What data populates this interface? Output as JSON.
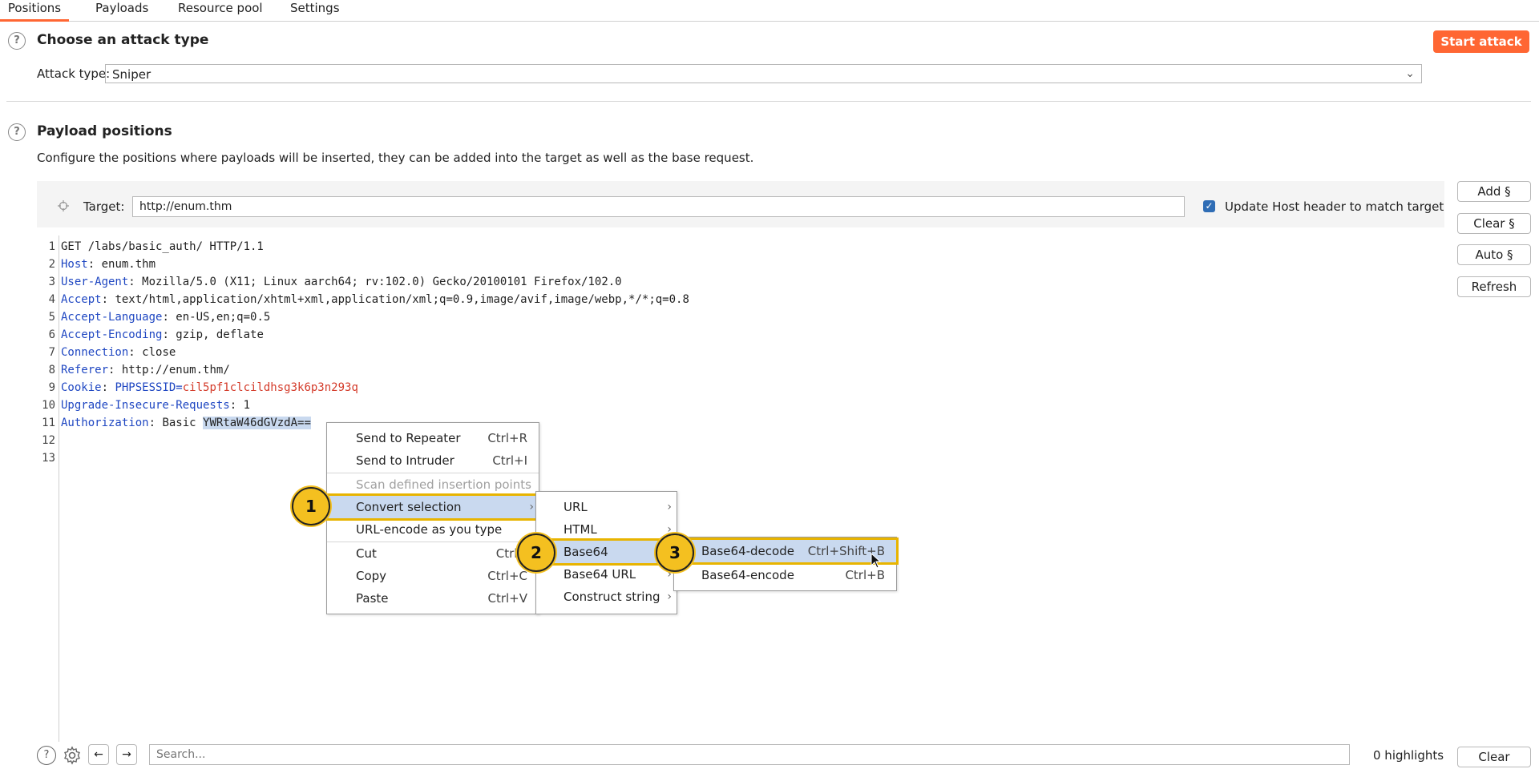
{
  "tabs": [
    "Positions",
    "Payloads",
    "Resource pool",
    "Settings"
  ],
  "attack": {
    "title": "Choose an attack type",
    "start_label": "Start attack",
    "type_label": "Attack type:",
    "type_value": "Sniper"
  },
  "positions": {
    "title": "Payload positions",
    "description": "Configure the positions where payloads will be inserted, they can be added into the target as well as the base request.",
    "target_label": "Target:",
    "target_value": "http://enum.thm",
    "update_host_label": "Update Host header to match target",
    "update_host_checked": true
  },
  "side_buttons": [
    "Add §",
    "Clear §",
    "Auto §",
    "Refresh"
  ],
  "request": {
    "line_numbers": [
      "1",
      "2",
      "3",
      "4",
      "5",
      "6",
      "7",
      "8",
      "9",
      "10",
      "11",
      "12",
      "13"
    ],
    "line1": "GET /labs/basic_auth/ HTTP/1.1",
    "headers": [
      {
        "name": "Host",
        "value": " enum.thm"
      },
      {
        "name": "User-Agent",
        "value": " Mozilla/5.0 (X11; Linux aarch64; rv:102.0) Gecko/20100101 Firefox/102.0"
      },
      {
        "name": "Accept",
        "value": " text/html,application/xhtml+xml,application/xml;q=0.9,image/avif,image/webp,*/*;q=0.8"
      },
      {
        "name": "Accept-Language",
        "value": " en-US,en;q=0.5"
      },
      {
        "name": "Accept-Encoding",
        "value": " gzip, deflate"
      },
      {
        "name": "Connection",
        "value": " close"
      },
      {
        "name": "Referer",
        "value": " http://enum.thm/"
      }
    ],
    "cookie_name": "Cookie",
    "cookie_key": "PHPSESSID",
    "cookie_value": "cil5pf1clcildhsg3k6p3n293q",
    "upgrade_name": "Upgrade-Insecure-Requests",
    "upgrade_value": " 1",
    "auth_name": "Authorization",
    "auth_scheme": " Basic ",
    "auth_selected": "YWRtaW46dGVzdA=="
  },
  "context_menu": {
    "send_repeater": "Send to Repeater",
    "send_repeater_sc": "Ctrl+R",
    "send_intruder": "Send to Intruder",
    "send_intruder_sc": "Ctrl+I",
    "scan": "Scan defined insertion points",
    "convert": "Convert selection",
    "urlencode": "URL-encode as you type",
    "cut": "Cut",
    "cut_sc": "Ctrl+",
    "copy": "Copy",
    "copy_sc": "Ctrl+C",
    "paste": "Paste",
    "paste_sc": "Ctrl+V"
  },
  "convert_menu": [
    "URL",
    "HTML",
    "Base64",
    "Base64 URL",
    "Construct string"
  ],
  "base64_menu": {
    "decode": "Base64-decode",
    "decode_sc": "Ctrl+Shift+B",
    "encode": "Base64-encode",
    "encode_sc": "Ctrl+B"
  },
  "badges": [
    "1",
    "2",
    "3"
  ],
  "bottom": {
    "search_placeholder": "Search...",
    "highlights": "0 highlights",
    "clear_label": "Clear"
  },
  "icons": {
    "help": "question-circle-icon",
    "settings": "gear-icon",
    "back": "arrow-left-icon",
    "forward": "arrow-right-icon",
    "target": "crosshair-icon",
    "cursor": "mouse-pointer-icon"
  },
  "colors": {
    "accent": "#ff6633",
    "header_name": "#1f47c2",
    "cookie_value": "#d43b2a",
    "selection": "#c9d9ef",
    "badge": "#f4c020"
  }
}
